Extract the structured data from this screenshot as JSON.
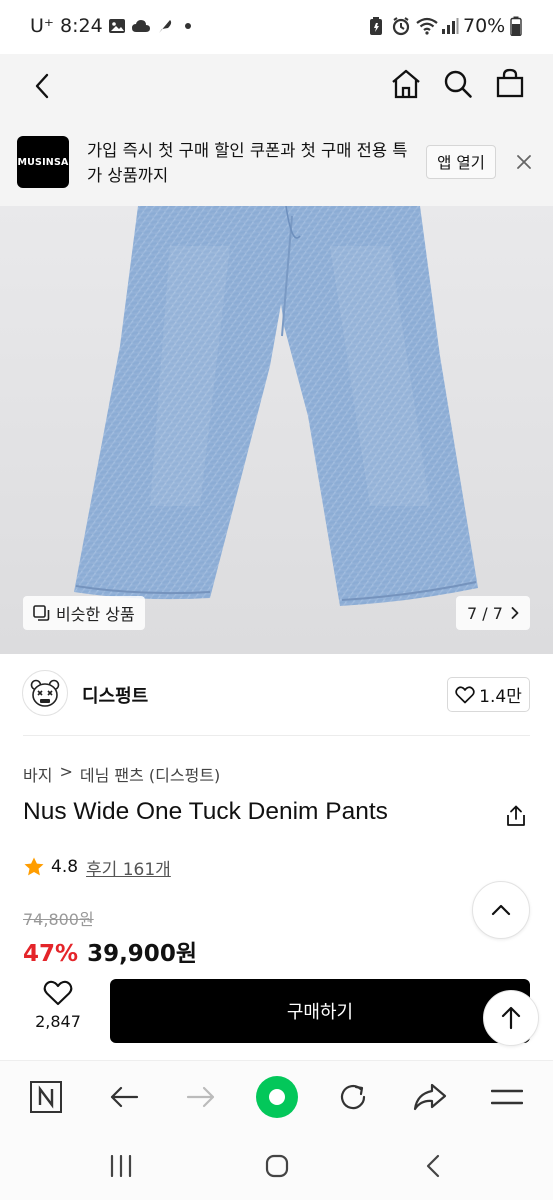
{
  "status_bar": {
    "carrier": "U⁺",
    "time": "8:24",
    "battery": "70%"
  },
  "nav": {
    "back_icon": "chevron-left-icon",
    "home_icon": "home-icon",
    "search_icon": "search-icon",
    "cart_icon": "shopping-bag-icon"
  },
  "banner": {
    "logo_text": "MUSINSA",
    "message": "가입 즉시 첫 구매 할인 쿠폰과 첫 구매 전용 특가 상품까지",
    "open_app_label": "앱 열기"
  },
  "gallery": {
    "similar_label": "비슷한 상품",
    "counter": "7 / 7"
  },
  "brand": {
    "name": "디스펑트",
    "like_count": "1.4만"
  },
  "product": {
    "breadcrumb_category": "바지",
    "breadcrumb_separator": ">",
    "breadcrumb_sub": "데님 팬츠 (디스펑트)",
    "title": "Nus Wide One Tuck Denim Pants",
    "rating": "4.8",
    "review_label": "후기 161개",
    "original_price": "74,800원",
    "discount": "47%",
    "sale_price": "39,900원"
  },
  "purchase": {
    "wish_count": "2,847",
    "buy_label": "구매하기"
  },
  "colors": {
    "discount_red": "#e4252a",
    "star_orange": "#ff9d00",
    "browser_green": "#03c75a",
    "denim": "#8fb0d6"
  }
}
